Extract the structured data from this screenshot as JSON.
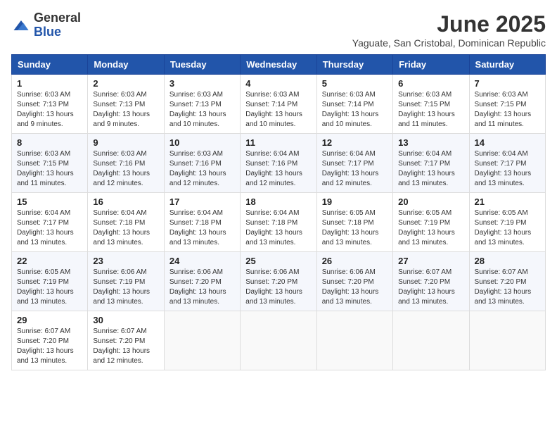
{
  "header": {
    "logo": {
      "general": "General",
      "blue": "Blue"
    },
    "title": "June 2025",
    "subtitle": "Yaguate, San Cristobal, Dominican Republic"
  },
  "days_of_week": [
    "Sunday",
    "Monday",
    "Tuesday",
    "Wednesday",
    "Thursday",
    "Friday",
    "Saturday"
  ],
  "weeks": [
    [
      {
        "day": "1",
        "sunrise": "Sunrise: 6:03 AM",
        "sunset": "Sunset: 7:13 PM",
        "daylight": "Daylight: 13 hours and 9 minutes."
      },
      {
        "day": "2",
        "sunrise": "Sunrise: 6:03 AM",
        "sunset": "Sunset: 7:13 PM",
        "daylight": "Daylight: 13 hours and 9 minutes."
      },
      {
        "day": "3",
        "sunrise": "Sunrise: 6:03 AM",
        "sunset": "Sunset: 7:13 PM",
        "daylight": "Daylight: 13 hours and 10 minutes."
      },
      {
        "day": "4",
        "sunrise": "Sunrise: 6:03 AM",
        "sunset": "Sunset: 7:14 PM",
        "daylight": "Daylight: 13 hours and 10 minutes."
      },
      {
        "day": "5",
        "sunrise": "Sunrise: 6:03 AM",
        "sunset": "Sunset: 7:14 PM",
        "daylight": "Daylight: 13 hours and 10 minutes."
      },
      {
        "day": "6",
        "sunrise": "Sunrise: 6:03 AM",
        "sunset": "Sunset: 7:15 PM",
        "daylight": "Daylight: 13 hours and 11 minutes."
      },
      {
        "day": "7",
        "sunrise": "Sunrise: 6:03 AM",
        "sunset": "Sunset: 7:15 PM",
        "daylight": "Daylight: 13 hours and 11 minutes."
      }
    ],
    [
      {
        "day": "8",
        "sunrise": "Sunrise: 6:03 AM",
        "sunset": "Sunset: 7:15 PM",
        "daylight": "Daylight: 13 hours and 11 minutes."
      },
      {
        "day": "9",
        "sunrise": "Sunrise: 6:03 AM",
        "sunset": "Sunset: 7:16 PM",
        "daylight": "Daylight: 13 hours and 12 minutes."
      },
      {
        "day": "10",
        "sunrise": "Sunrise: 6:03 AM",
        "sunset": "Sunset: 7:16 PM",
        "daylight": "Daylight: 13 hours and 12 minutes."
      },
      {
        "day": "11",
        "sunrise": "Sunrise: 6:04 AM",
        "sunset": "Sunset: 7:16 PM",
        "daylight": "Daylight: 13 hours and 12 minutes."
      },
      {
        "day": "12",
        "sunrise": "Sunrise: 6:04 AM",
        "sunset": "Sunset: 7:17 PM",
        "daylight": "Daylight: 13 hours and 12 minutes."
      },
      {
        "day": "13",
        "sunrise": "Sunrise: 6:04 AM",
        "sunset": "Sunset: 7:17 PM",
        "daylight": "Daylight: 13 hours and 13 minutes."
      },
      {
        "day": "14",
        "sunrise": "Sunrise: 6:04 AM",
        "sunset": "Sunset: 7:17 PM",
        "daylight": "Daylight: 13 hours and 13 minutes."
      }
    ],
    [
      {
        "day": "15",
        "sunrise": "Sunrise: 6:04 AM",
        "sunset": "Sunset: 7:17 PM",
        "daylight": "Daylight: 13 hours and 13 minutes."
      },
      {
        "day": "16",
        "sunrise": "Sunrise: 6:04 AM",
        "sunset": "Sunset: 7:18 PM",
        "daylight": "Daylight: 13 hours and 13 minutes."
      },
      {
        "day": "17",
        "sunrise": "Sunrise: 6:04 AM",
        "sunset": "Sunset: 7:18 PM",
        "daylight": "Daylight: 13 hours and 13 minutes."
      },
      {
        "day": "18",
        "sunrise": "Sunrise: 6:04 AM",
        "sunset": "Sunset: 7:18 PM",
        "daylight": "Daylight: 13 hours and 13 minutes."
      },
      {
        "day": "19",
        "sunrise": "Sunrise: 6:05 AM",
        "sunset": "Sunset: 7:18 PM",
        "daylight": "Daylight: 13 hours and 13 minutes."
      },
      {
        "day": "20",
        "sunrise": "Sunrise: 6:05 AM",
        "sunset": "Sunset: 7:19 PM",
        "daylight": "Daylight: 13 hours and 13 minutes."
      },
      {
        "day": "21",
        "sunrise": "Sunrise: 6:05 AM",
        "sunset": "Sunset: 7:19 PM",
        "daylight": "Daylight: 13 hours and 13 minutes."
      }
    ],
    [
      {
        "day": "22",
        "sunrise": "Sunrise: 6:05 AM",
        "sunset": "Sunset: 7:19 PM",
        "daylight": "Daylight: 13 hours and 13 minutes."
      },
      {
        "day": "23",
        "sunrise": "Sunrise: 6:06 AM",
        "sunset": "Sunset: 7:19 PM",
        "daylight": "Daylight: 13 hours and 13 minutes."
      },
      {
        "day": "24",
        "sunrise": "Sunrise: 6:06 AM",
        "sunset": "Sunset: 7:20 PM",
        "daylight": "Daylight: 13 hours and 13 minutes."
      },
      {
        "day": "25",
        "sunrise": "Sunrise: 6:06 AM",
        "sunset": "Sunset: 7:20 PM",
        "daylight": "Daylight: 13 hours and 13 minutes."
      },
      {
        "day": "26",
        "sunrise": "Sunrise: 6:06 AM",
        "sunset": "Sunset: 7:20 PM",
        "daylight": "Daylight: 13 hours and 13 minutes."
      },
      {
        "day": "27",
        "sunrise": "Sunrise: 6:07 AM",
        "sunset": "Sunset: 7:20 PM",
        "daylight": "Daylight: 13 hours and 13 minutes."
      },
      {
        "day": "28",
        "sunrise": "Sunrise: 6:07 AM",
        "sunset": "Sunset: 7:20 PM",
        "daylight": "Daylight: 13 hours and 13 minutes."
      }
    ],
    [
      {
        "day": "29",
        "sunrise": "Sunrise: 6:07 AM",
        "sunset": "Sunset: 7:20 PM",
        "daylight": "Daylight: 13 hours and 13 minutes."
      },
      {
        "day": "30",
        "sunrise": "Sunrise: 6:07 AM",
        "sunset": "Sunset: 7:20 PM",
        "daylight": "Daylight: 13 hours and 12 minutes."
      },
      null,
      null,
      null,
      null,
      null
    ]
  ]
}
